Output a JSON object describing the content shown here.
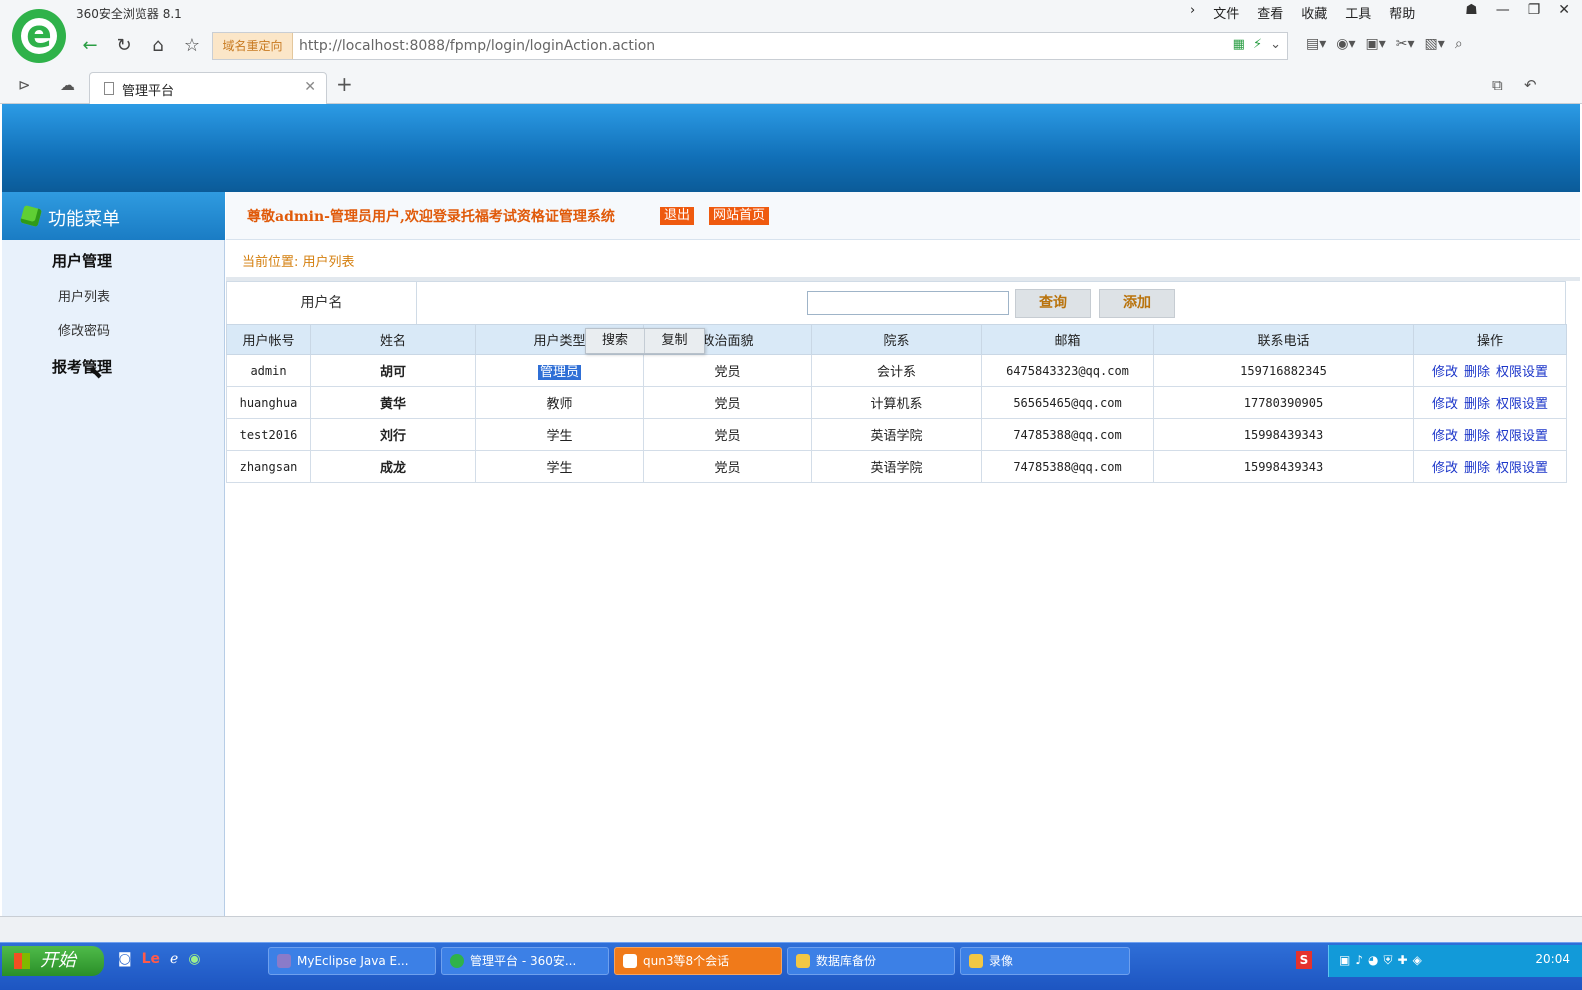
{
  "browser": {
    "app_title": "360安全浏览器 8.1",
    "menu": [
      "文件",
      "查看",
      "收藏",
      "工具",
      "帮助"
    ],
    "address_tag": "域名重定向",
    "url": "http://localhost:8088/fpmp/login/loginAction.action",
    "tab_title": "管理平台"
  },
  "sidebar": {
    "title": "功能菜单",
    "groups": [
      {
        "label": "用户管理",
        "items": [
          "用户列表",
          "修改密码"
        ]
      },
      {
        "label": "报考管理",
        "items": []
      }
    ]
  },
  "header": {
    "welcome": "尊敬admin-管理员用户,欢迎登录托福考试资格证管理系统",
    "logout": "退出",
    "home": "网站首页"
  },
  "breadcrumb": "当前位置: 用户列表",
  "search": {
    "label": "用户名",
    "value": "",
    "query_button": "查询",
    "add_button": "添加"
  },
  "context_menu": [
    "搜索",
    "复制"
  ],
  "table": {
    "headers": [
      "用户帐号",
      "姓名",
      "用户类型",
      "政治面貌",
      "院系",
      "邮箱",
      "联系电话",
      "操作"
    ],
    "rows": [
      [
        "admin",
        "胡可",
        "管理员",
        "党员",
        "会计系",
        "6475843323@qq.com",
        "159716882345"
      ],
      [
        "huanghua",
        "黄华",
        "教师",
        "党员",
        "计算机系",
        "56565465@qq.com",
        "17780390905"
      ],
      [
        "test2016",
        "刘行",
        "学生",
        "党员",
        "英语学院",
        "74785388@qq.com",
        "15998439343"
      ],
      [
        "zhangsan",
        "成龙",
        "学生",
        "党员",
        "英语学院",
        "74785388@qq.com",
        "15998439343"
      ]
    ],
    "actions": [
      "修改",
      "删除",
      "权限设置"
    ]
  },
  "taskbar": {
    "start": "开始",
    "tasks": [
      "MyEclipse Java E...",
      "管理平台 - 360安...",
      "qun3等8个会话",
      "数据库备份",
      "录像"
    ],
    "clock": "20:04"
  },
  "colors": {
    "banner": "#1a7cc4",
    "welcome_text": "#e05a0a",
    "link": "#1b35c9",
    "sidebar_bg": "#e8f1fb"
  }
}
